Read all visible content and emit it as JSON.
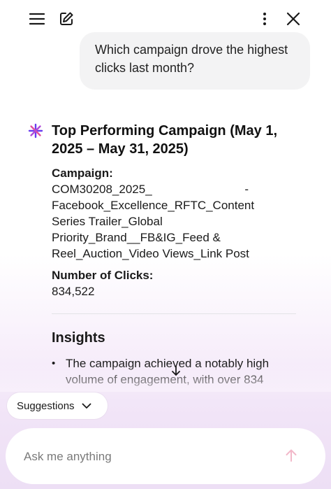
{
  "toolbar": {
    "menu_icon": "hamburger-menu-icon",
    "new_chat_icon": "edit-icon",
    "more_icon": "more-vertical-icon",
    "close_icon": "close-icon"
  },
  "chat": {
    "user_message": "Which campaign drove the highest clicks last month?",
    "answer": {
      "title": "Top Performing Campaign (May 1, 2025 – May 31, 2025)",
      "campaign_label": "Campaign:",
      "campaign_value_line1": "COM30208_2025_",
      "campaign_value_dash": "-",
      "campaign_value_rest": "Facebook_Excellence_RFTC_Content Series Trailer_Global Priority_Brand__FB&IG_Feed & Reel_Auction_Video Views_Link Post",
      "clicks_label": "Number of Clicks:",
      "clicks_value": "834,522",
      "insights_heading": "Insights",
      "insight_bullet": "•",
      "insight_1": "The campaign achieved a notably high volume of engagement, with over 834"
    }
  },
  "suggestions": {
    "label": "Suggestions"
  },
  "composer": {
    "placeholder": "Ask me anything"
  },
  "colors": {
    "sparkle_purple": "#6a3df0",
    "sparkle_pink": "#e0509e",
    "send_icon": "#f2b8c9",
    "bubble_bg": "#f3f3f4"
  }
}
